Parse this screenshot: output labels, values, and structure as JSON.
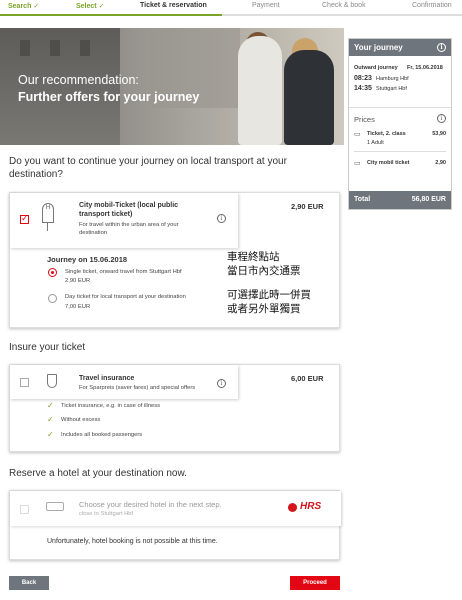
{
  "progress": {
    "steps": [
      {
        "label": "Search",
        "status": "done"
      },
      {
        "label": "Select",
        "status": "done"
      },
      {
        "label": "Ticket & reservation",
        "status": "active"
      },
      {
        "label": "Payment",
        "status": "upcoming"
      },
      {
        "label": "Check & book",
        "status": "upcoming"
      },
      {
        "label": "Confirmation",
        "status": "upcoming"
      }
    ],
    "check_glyph": "✓"
  },
  "hero": {
    "line1": "Our recommendation:",
    "line2": "Further offers for your journey"
  },
  "sidebar": {
    "title": "Your journey",
    "outward_label": "Outward journey",
    "outward_date": "Fr, 15.06.2018",
    "dep_time": "08:23",
    "dep_station": "Hamburg Hbf",
    "arr_time": "14:35",
    "arr_station": "Stuttgart Hbf",
    "prices_label": "Prices",
    "ticket_label": "Ticket, 2. class",
    "ticket_sub": "1 Adult",
    "ticket_price": "53,90",
    "city_label": "City mobil ticket",
    "city_price": "2,90",
    "total_label": "Total",
    "total_price": "56,80 EUR"
  },
  "local": {
    "question": "Do you want to continue your journey on local transport at your destination?",
    "title": "City mobil-Ticket (local public transport ticket)",
    "title_l1": "City mobil-Ticket (local public",
    "title_l2": "transport ticket)",
    "desc_l1": "For travel within the urban area of your",
    "desc_l2": "destination",
    "price": "2,90 EUR",
    "date_heading": "Journey on 15.06.2018",
    "opt1": "Single ticket, onward travel from Stuttgart Hbf",
    "opt1_price": "2,90 EUR",
    "opt2": "Day ticket for local transport at your destination",
    "opt2_price": "7,00 EUR",
    "note1_l1": "車程終點站",
    "note1_l2": "當日市內交通票",
    "note2_l1": "可選擇此時一併買",
    "note2_l2": "或者另外單獨買"
  },
  "insurance": {
    "heading": "Insure your ticket",
    "title": "Travel insurance",
    "desc": "For Sparpreis (saver fares) and special offers",
    "price": "6,00 EUR",
    "features": [
      "Ticket insurance, e.g. in case of illness",
      "Without excess",
      "Includes all booked passengers"
    ]
  },
  "hotel": {
    "heading": "Reserve a hotel at your destination now.",
    "title": "Choose your desired hotel in the next step.",
    "sub": "close to Stuttgart Hbf",
    "brand": "HRS",
    "notice": "Unfortunately, hotel booking is not possible at this time."
  },
  "buttons": {
    "back": "Back",
    "proceed": "Proceed"
  },
  "colors": {
    "accent_red": "#e30613",
    "done_green": "#7ba428",
    "sidebar_gray": "#6f757c"
  }
}
